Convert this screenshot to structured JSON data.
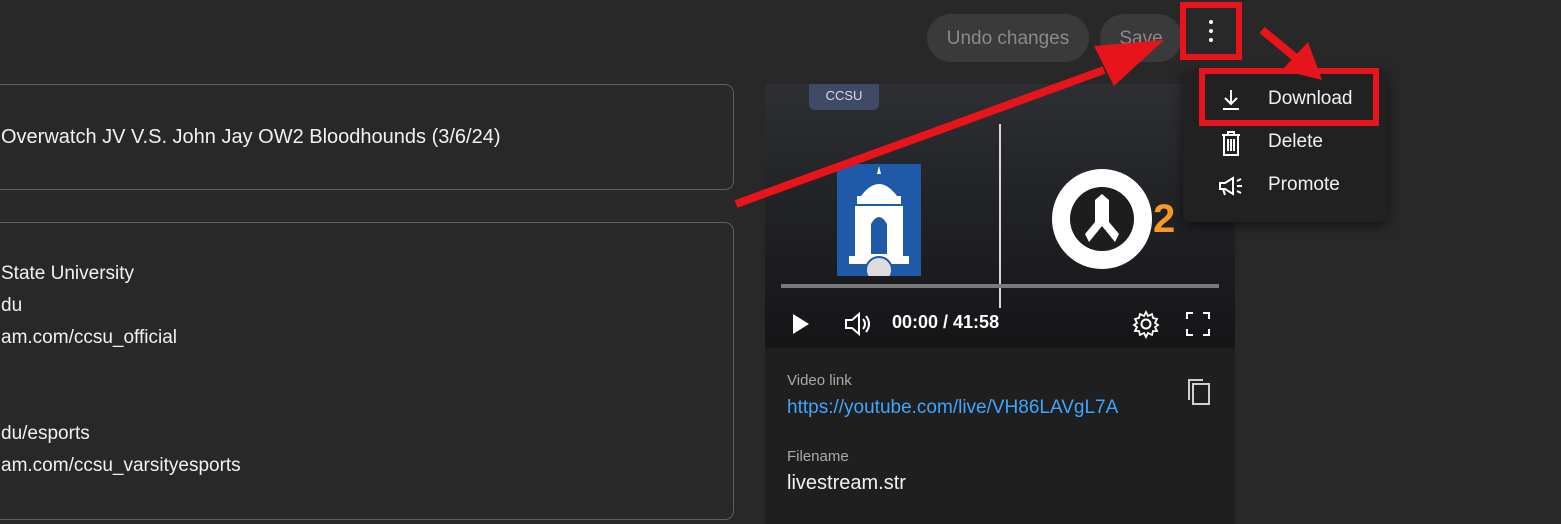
{
  "toolbar": {
    "undo_label": "Undo changes",
    "save_label": "Save"
  },
  "details": {
    "title_value": "Overwatch JV V.S. John Jay OW2 Bloodhounds (3/6/24)",
    "description_lines": [
      "State University",
      "du",
      "am.com/ccsu_official",
      "",
      "",
      "du/esports",
      "am.com/ccsu_varsityesports"
    ]
  },
  "player": {
    "sign_text": "CCSU",
    "time": "00:00 / 41:58",
    "progress": 0
  },
  "info": {
    "video_link_label": "Video link",
    "video_link": "https://youtube.com/live/VH86LAVgL7A",
    "filename_label": "Filename",
    "filename": "livestream.str"
  },
  "menu": {
    "items": [
      {
        "label": "Download",
        "icon": "download-icon"
      },
      {
        "label": "Delete",
        "icon": "trash-icon"
      },
      {
        "label": "Promote",
        "icon": "megaphone-icon"
      }
    ]
  },
  "colors": {
    "background": "#282828",
    "annotation_red": "#e8141b",
    "link_blue": "#3ea6ff",
    "ow2_orange": "#f59a23"
  }
}
